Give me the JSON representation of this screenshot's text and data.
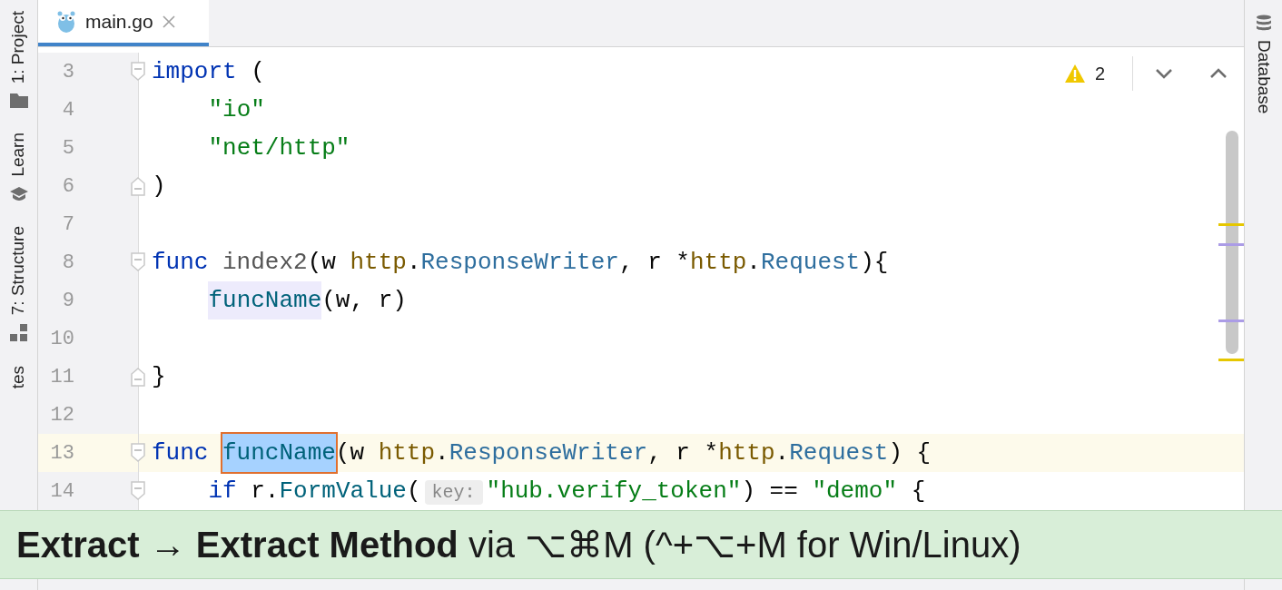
{
  "left_toolbar": [
    {
      "label": "1: Project"
    },
    {
      "label": "Learn"
    },
    {
      "label": "7: Structure"
    },
    {
      "label": "tes"
    }
  ],
  "tabs": [
    {
      "label": "main.go",
      "selected": true
    }
  ],
  "inspections": {
    "warnings": "2"
  },
  "lines": [
    {
      "number": "3",
      "kind": "fold-start",
      "current": false,
      "tokens": [
        {
          "text": "import",
          "kind": "keyword"
        },
        {
          "text": " (",
          "kind": "plain"
        }
      ]
    },
    {
      "number": "4",
      "kind": "plain",
      "current": false,
      "tokens": [
        {
          "text": "    \"io\"",
          "kind": "string"
        }
      ]
    },
    {
      "number": "5",
      "kind": "plain",
      "current": false,
      "tokens": [
        {
          "text": "    \"net/http\"",
          "kind": "string"
        }
      ]
    },
    {
      "number": "6",
      "kind": "fold-end",
      "current": false,
      "tokens": [
        {
          "text": ")",
          "kind": "plain"
        }
      ]
    },
    {
      "number": "7",
      "kind": "plain",
      "current": false
    },
    {
      "number": "8",
      "kind": "fold-start",
      "current": false,
      "tokens": [
        {
          "text": "func ",
          "kind": "keyword"
        },
        {
          "text": "index2",
          "kind": "unused"
        },
        {
          "text": "(w ",
          "kind": "plain"
        },
        {
          "text": "http",
          "kind": "package"
        },
        {
          "text": ".",
          "kind": "plain"
        },
        {
          "text": "ResponseWriter",
          "kind": "type"
        },
        {
          "text": ", r *",
          "kind": "plain"
        },
        {
          "text": "http",
          "kind": "package"
        },
        {
          "text": ".",
          "kind": "plain"
        },
        {
          "text": "Request",
          "kind": "type"
        },
        {
          "text": "){",
          "kind": "plain"
        }
      ]
    },
    {
      "number": "9",
      "kind": "plain",
      "current": false,
      "tokens": [
        {
          "text": "    funcName",
          "kind": "call"
        },
        {
          "text": "(w, r)",
          "kind": "plain"
        }
      ]
    },
    {
      "number": "10",
      "kind": "plain",
      "current": false
    },
    {
      "number": "11",
      "kind": "fold-end",
      "current": false,
      "tokens": [
        {
          "text": "}",
          "kind": "plain"
        }
      ]
    },
    {
      "number": "12",
      "kind": "plain",
      "current": false
    },
    {
      "number": "13",
      "kind": "fold-start",
      "current": true,
      "tokens": [
        {
          "text": "func ",
          "kind": "keyword"
        },
        {
          "text": "funcName",
          "kind": "selected"
        },
        {
          "text": "(w ",
          "kind": "plain"
        },
        {
          "text": "http",
          "kind": "package"
        },
        {
          "text": ".",
          "kind": "plain"
        },
        {
          "text": "ResponseWriter",
          "kind": "type"
        },
        {
          "text": ", r *",
          "kind": "plain"
        },
        {
          "text": "http",
          "kind": "package"
        },
        {
          "text": ".",
          "kind": "plain"
        },
        {
          "text": "Request",
          "kind": "type"
        },
        {
          "text": ") {",
          "kind": "plain"
        }
      ]
    },
    {
      "number": "14",
      "kind": "fold-start",
      "current": false,
      "tokens": [
        {
          "text": "    if",
          "kind": "keyword"
        },
        {
          "text": " r.",
          "kind": "plain"
        },
        {
          "text": "FormValue",
          "kind": "method"
        },
        {
          "text": "(",
          "kind": "plain"
        },
        {
          "text": "key:",
          "kind": "hint"
        },
        {
          "text": "\"hub.verify_token\"",
          "kind": "string"
        },
        {
          "text": ") == ",
          "kind": "plain"
        },
        {
          "text": "\"demo\"",
          "kind": "string"
        },
        {
          "text": " {",
          "kind": "plain"
        }
      ]
    }
  ],
  "right_toolbar": [
    {
      "label": "Database"
    }
  ],
  "caption": "**Extract → Extract Method** via ⌥⌘M (^+⌥+M for Win/Linux)"
}
